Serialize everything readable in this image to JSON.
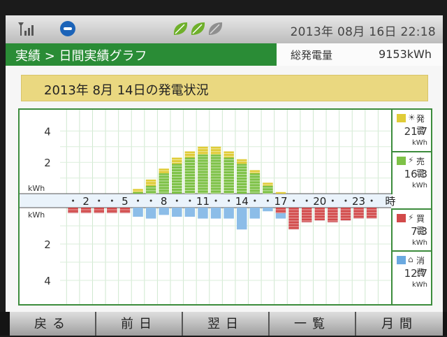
{
  "status_bar": {
    "icons": [
      "antenna-signal-icon",
      "no-entry-icon",
      "eco-leaves-icon"
    ],
    "datetime": "2013年 08月 16日  22:18"
  },
  "title_bar": {
    "breadcrumb": "実績 > 日間実績グラフ",
    "total_label": "総発電量",
    "total_value": "9153kWh"
  },
  "heading": "2013年   8月 14日の発電状況",
  "chart_data": {
    "type": "bar",
    "x": [
      1,
      2,
      3,
      4,
      5,
      6,
      7,
      8,
      9,
      10,
      11,
      12,
      13,
      14,
      15,
      16,
      17,
      18,
      19,
      20,
      21,
      22,
      23,
      24
    ],
    "x_tick_labels": [
      "2",
      "5",
      "8",
      "11",
      "14",
      "17",
      "20",
      "23"
    ],
    "x_unit": "時",
    "y_unit": "kWh",
    "upper_yticks": [
      "4",
      "2"
    ],
    "lower_yticks": [
      "2",
      "4"
    ],
    "upper_ylim": [
      0,
      5
    ],
    "lower_ylim": [
      0,
      5
    ],
    "series": [
      {
        "name": "発電",
        "color": "#e0cc38",
        "direction": "up",
        "values": [
          0,
          0,
          0,
          0,
          0,
          0.3,
          0.9,
          1.6,
          2.3,
          2.7,
          3.0,
          3.0,
          2.7,
          2.2,
          1.5,
          0.7,
          0.1,
          0,
          0,
          0,
          0,
          0,
          0,
          0
        ]
      },
      {
        "name": "売電",
        "color": "#7ec247",
        "direction": "up",
        "values": [
          0,
          0,
          0,
          0,
          0,
          0.1,
          0.5,
          1.3,
          1.9,
          2.3,
          2.5,
          2.5,
          2.3,
          1.9,
          1.3,
          0.5,
          0,
          0,
          0,
          0,
          0,
          0,
          0,
          0
        ]
      },
      {
        "name": "買電",
        "color": "#d24a4a",
        "direction": "down",
        "values": [
          0.3,
          0.3,
          0.3,
          0.3,
          0.3,
          0,
          0,
          0,
          0,
          0,
          0,
          0,
          0,
          0,
          0,
          0,
          0.3,
          1.2,
          0.8,
          0.7,
          0.8,
          0.7,
          0.6,
          0.6
        ]
      },
      {
        "name": "消費",
        "color": "#8cbde8",
        "direction": "down",
        "values": [
          0.3,
          0.3,
          0.3,
          0.3,
          0.3,
          0.5,
          0.6,
          0.4,
          0.5,
          0.5,
          0.6,
          0.6,
          0.6,
          1.2,
          0.6,
          0.2,
          0.6,
          1.2,
          0.8,
          0.7,
          0.8,
          0.7,
          0.6,
          0.6
        ]
      }
    ],
    "grid": true,
    "legend_position": "right"
  },
  "legend": [
    {
      "icon": "sun-icon",
      "glyph": "☀",
      "name": "発電",
      "value": "21.7",
      "unit": "kWh",
      "color": "#e0cc38"
    },
    {
      "icon": "pylon-icon",
      "glyph": "⚡",
      "name": "売電",
      "value": "16.3",
      "unit": "kWh",
      "color": "#7ec247"
    },
    {
      "icon": "pylon-icon",
      "glyph": "⚡",
      "name": "買電",
      "value": "7.3",
      "unit": "kWh",
      "color": "#d24a4a"
    },
    {
      "icon": "house-icon",
      "glyph": "⌂",
      "name": "消費",
      "value": "12.7",
      "unit": "kWh",
      "color": "#6aa9e0"
    }
  ],
  "bottom_nav": [
    {
      "label": "戻る"
    },
    {
      "label": "前日"
    },
    {
      "label": "翌日"
    },
    {
      "label": "一覧"
    },
    {
      "label": "月間"
    }
  ]
}
